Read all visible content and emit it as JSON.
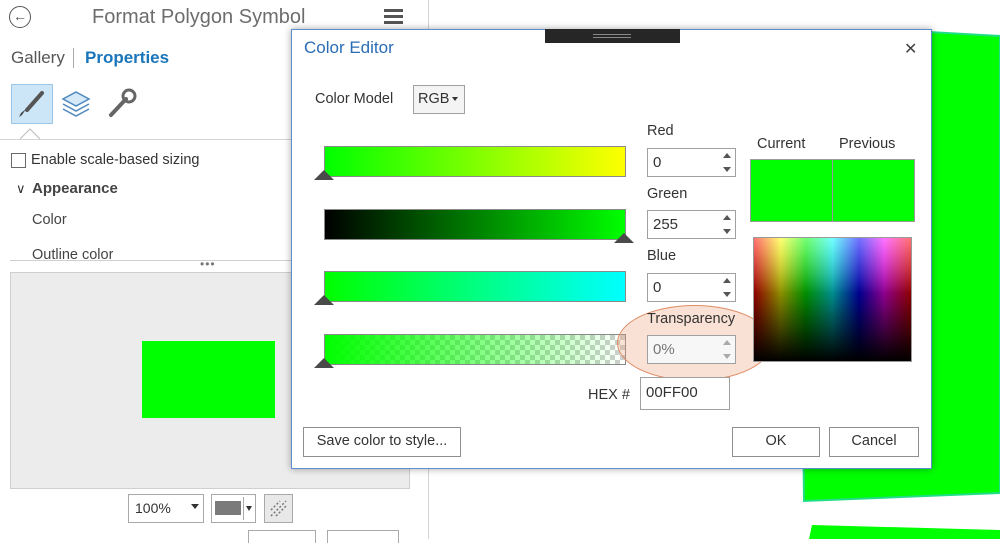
{
  "left_pane": {
    "title": "Format Polygon Symbol",
    "tabs": {
      "gallery": "Gallery",
      "properties": "Properties"
    },
    "tools": [
      "paintbrush-icon",
      "layers-icon",
      "wrench-icon"
    ],
    "enable_scale_label": "Enable scale-based sizing",
    "section_title": "Appearance",
    "color_label": "Color",
    "outline_label": "Outline color",
    "splitter_dots": "•••",
    "zoom_value": "100%",
    "symbol_color": "#00ff00",
    "background_swatch_color": "#7a7a7a"
  },
  "dialog": {
    "title": "Color Editor",
    "close_glyph": "✕",
    "color_model_label": "Color Model",
    "color_model_value": "RGB",
    "channels": {
      "red": {
        "label": "Red",
        "value": "0"
      },
      "green": {
        "label": "Green",
        "value": "255"
      },
      "blue": {
        "label": "Blue",
        "value": "0"
      },
      "transparency": {
        "label": "Transparency",
        "value": "0%"
      }
    },
    "hex_label": "HEX #",
    "hex_value": "00FF00",
    "current_label": "Current",
    "previous_label": "Previous",
    "current_color": "#00ff00",
    "previous_color": "#00ff00",
    "save_button": "Save color to style...",
    "ok_button": "OK",
    "cancel_button": "Cancel"
  },
  "map": {
    "polygon_color": "#00ff00"
  }
}
